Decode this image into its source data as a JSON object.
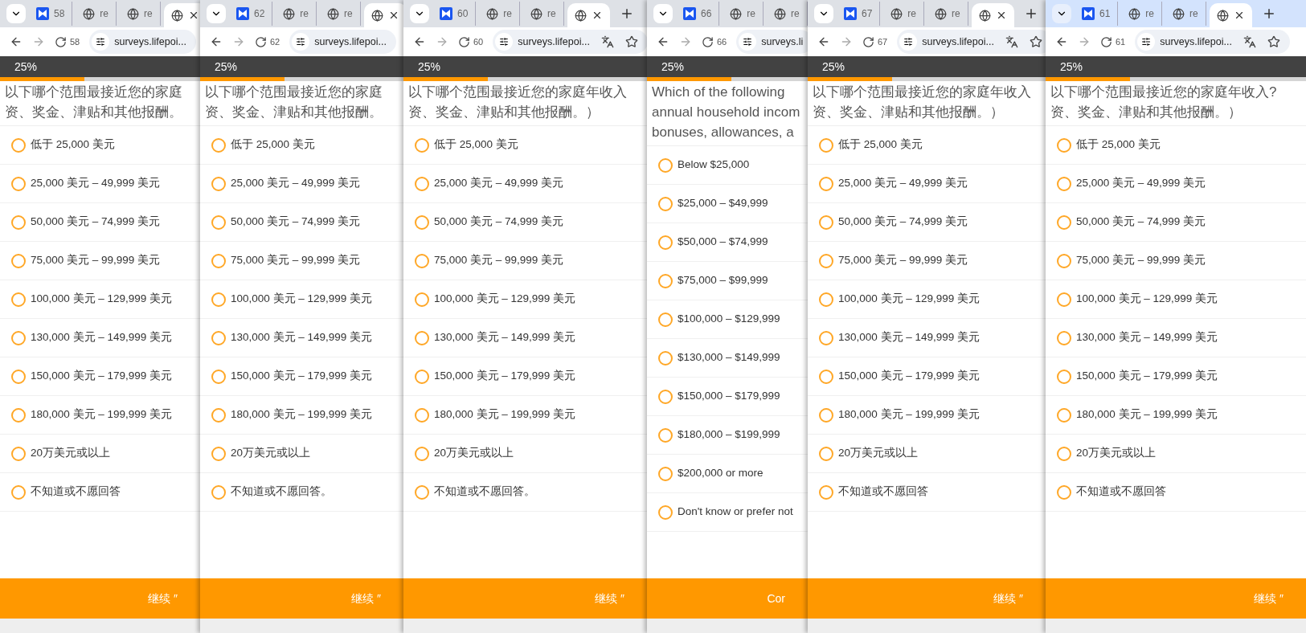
{
  "windows": [
    {
      "focused": false,
      "tabs": [
        {
          "kind": "app",
          "label": "58",
          "selected": false
        },
        {
          "kind": "web",
          "label": "re",
          "selected": false
        },
        {
          "kind": "web",
          "label": "re",
          "selected": false
        },
        {
          "kind": "web",
          "selected": true
        }
      ],
      "new_tab": false,
      "address": {
        "number": "58",
        "url": "surveys.lifepoi...",
        "translate": false,
        "star": false
      },
      "progress": {
        "label": "25%",
        "level": 0.25
      },
      "question": [
        "以下哪个范围最接近您的家庭",
        "资、奖金、津贴和其他报酬。"
      ],
      "options": [
        {
          "label": "低于 25,000 美元",
          "selected": false
        },
        {
          "label": "25,000 美元 – 49,999 美元",
          "selected": false
        },
        {
          "label": "50,000 美元 – 74,999 美元",
          "selected": false
        },
        {
          "label": "75,000 美元 – 99,999 美元",
          "selected": false
        },
        {
          "label": "100,000 美元 – 129,999 美元",
          "selected": false
        },
        {
          "label": "130,000 美元 – 149,999 美元",
          "selected": false
        },
        {
          "label": "150,000 美元 – 179,999 美元",
          "selected": false
        },
        {
          "label": "180,000 美元 – 199,999 美元",
          "selected": false
        },
        {
          "label": "20万美元或以上",
          "selected": false
        },
        {
          "label": "不知道或不愿回答",
          "selected": false
        }
      ],
      "continue": "继续 ″"
    },
    {
      "focused": false,
      "tabs": [
        {
          "kind": "app",
          "label": "62",
          "selected": false
        },
        {
          "kind": "web",
          "label": "re",
          "selected": false
        },
        {
          "kind": "web",
          "label": "re",
          "selected": false
        },
        {
          "kind": "web",
          "selected": true
        }
      ],
      "new_tab": false,
      "address": {
        "number": "62",
        "url": "surveys.lifepoi...",
        "translate": false,
        "star": false
      },
      "progress": {
        "label": "25%",
        "level": 0.25
      },
      "question": [
        "以下哪个范围最接近您的家庭",
        "资、奖金、津贴和其他报酬。"
      ],
      "options": [
        {
          "label": "低于 25,000 美元",
          "selected": false
        },
        {
          "label": "25,000 美元 – 49,999 美元",
          "selected": false
        },
        {
          "label": "50,000 美元 – 74,999 美元",
          "selected": false
        },
        {
          "label": "75,000 美元 – 99,999 美元",
          "selected": false
        },
        {
          "label": "100,000 美元 – 129,999 美元",
          "selected": false
        },
        {
          "label": "130,000 美元 – 149,999 美元",
          "selected": false
        },
        {
          "label": "150,000 美元 – 179,999 美元",
          "selected": false
        },
        {
          "label": "180,000 美元 – 199,999 美元",
          "selected": false
        },
        {
          "label": "20万美元或以上",
          "selected": false
        },
        {
          "label": "不知道或不愿回答。",
          "selected": false
        }
      ],
      "continue": "继续 ″"
    },
    {
      "focused": false,
      "tabs": [
        {
          "kind": "app",
          "label": "60",
          "selected": false
        },
        {
          "kind": "web",
          "label": "re",
          "selected": false
        },
        {
          "kind": "web",
          "label": "re",
          "selected": false
        },
        {
          "kind": "web",
          "selected": true
        }
      ],
      "new_tab": true,
      "address": {
        "number": "60",
        "url": "surveys.lifepoi...",
        "translate": true,
        "star": true
      },
      "progress": {
        "label": "25%",
        "level": 0.25
      },
      "question": [
        "以下哪个范围最接近您的家庭年收入",
        "资、奖金、津贴和其他报酬。）"
      ],
      "options": [
        {
          "label": "低于 25,000 美元",
          "selected": false
        },
        {
          "label": "25,000 美元 – 49,999 美元",
          "selected": false
        },
        {
          "label": "50,000 美元 – 74,999 美元",
          "selected": false
        },
        {
          "label": "75,000 美元 – 99,999 美元",
          "selected": false
        },
        {
          "label": "100,000 美元 – 129,999 美元",
          "selected": false
        },
        {
          "label": "130,000 美元 – 149,999 美元",
          "selected": false
        },
        {
          "label": "150,000 美元 – 179,999 美元",
          "selected": false
        },
        {
          "label": "180,000 美元 – 199,999 美元",
          "selected": false
        },
        {
          "label": "20万美元或以上",
          "selected": false
        },
        {
          "label": "不知道或不愿回答。",
          "selected": false
        }
      ],
      "continue": "继续 ″"
    },
    {
      "focused": false,
      "tabs": [
        {
          "kind": "app",
          "label": "66",
          "selected": false
        },
        {
          "kind": "web",
          "label": "re",
          "selected": false
        },
        {
          "kind": "web",
          "label": "re",
          "selected": false
        }
      ],
      "address": {
        "number": "66",
        "url": "surveys.li",
        "translate": false,
        "star": false
      },
      "progress": {
        "label": "25%",
        "level": 0.25
      },
      "question": [
        "Which of the following",
        "annual household incom",
        "bonuses, allowances, a"
      ],
      "options": [
        {
          "label": "Below $25,000",
          "selected": false
        },
        {
          "label": "$25,000 – $49,999",
          "selected": false
        },
        {
          "label": "$50,000 – $74,999",
          "selected": false
        },
        {
          "label": "$75,000 – $99,999",
          "selected": false
        },
        {
          "label": "$100,000 – $129,999",
          "selected": false
        },
        {
          "label": "$130,000 – $149,999",
          "selected": false
        },
        {
          "label": "$150,000 – $179,999",
          "selected": false
        },
        {
          "label": "$180,000 – $199,999",
          "selected": false
        },
        {
          "label": "$200,000 or more",
          "selected": false
        },
        {
          "label": "Don't know or prefer not",
          "selected": false
        }
      ],
      "continue": "Cor"
    },
    {
      "focused": false,
      "tabs": [
        {
          "kind": "app",
          "label": "67",
          "selected": false
        },
        {
          "kind": "web",
          "label": "re",
          "selected": false
        },
        {
          "kind": "web",
          "label": "re",
          "selected": false
        },
        {
          "kind": "web",
          "selected": true
        }
      ],
      "new_tab": true,
      "address": {
        "number": "67",
        "url": "surveys.lifepoi...",
        "translate": true,
        "star": true
      },
      "progress": {
        "label": "25%",
        "level": 0.25
      },
      "question": [
        "以下哪个范围最接近您的家庭年收入",
        "资、奖金、津贴和其他报酬。）"
      ],
      "options": [
        {
          "label": "低于 25,000 美元",
          "selected": false
        },
        {
          "label": "25,000 美元 – 49,999 美元",
          "selected": false
        },
        {
          "label": "50,000 美元 – 74,999 美元",
          "selected": false
        },
        {
          "label": "75,000 美元 – 99,999 美元",
          "selected": false
        },
        {
          "label": "100,000 美元 – 129,999 美元",
          "selected": false
        },
        {
          "label": "130,000 美元 – 149,999 美元",
          "selected": false
        },
        {
          "label": "150,000 美元 – 179,999 美元",
          "selected": false
        },
        {
          "label": "180,000 美元 – 199,999 美元",
          "selected": false
        },
        {
          "label": "20万美元或以上",
          "selected": false
        },
        {
          "label": "不知道或不愿回答",
          "selected": false
        }
      ],
      "continue": "继续 ″"
    },
    {
      "focused": true,
      "tabs": [
        {
          "kind": "app",
          "label": "61",
          "selected": false
        },
        {
          "kind": "web",
          "label": "re",
          "selected": false
        },
        {
          "kind": "web",
          "label": "re",
          "selected": false
        },
        {
          "kind": "web",
          "selected": true
        }
      ],
      "new_tab": true,
      "address": {
        "number": "61",
        "url": "surveys.lifepoi...",
        "translate": true,
        "star": true
      },
      "progress": {
        "label": "25%",
        "level": 0.25
      },
      "question": [
        "以下哪个范围最接近您的家庭年收入?",
        "资、奖金、津贴和其他报酬。）"
      ],
      "options": [
        {
          "label": "低于 25,000 美元",
          "selected": false
        },
        {
          "label": "25,000 美元 – 49,999 美元",
          "selected": false
        },
        {
          "label": "50,000 美元 – 74,999 美元",
          "selected": false
        },
        {
          "label": "75,000 美元 – 99,999 美元",
          "selected": false
        },
        {
          "label": "100,000 美元 – 129,999 美元",
          "selected": false
        },
        {
          "label": "130,000 美元 – 149,999 美元",
          "selected": false
        },
        {
          "label": "150,000 美元 – 179,999 美元",
          "selected": false
        },
        {
          "label": "180,000 美元 – 199,999 美元",
          "selected": false
        },
        {
          "label": "20万美元或以上",
          "selected": false
        },
        {
          "label": "不知道或不愿回答",
          "selected": false
        }
      ],
      "continue": "继续 ″"
    }
  ]
}
